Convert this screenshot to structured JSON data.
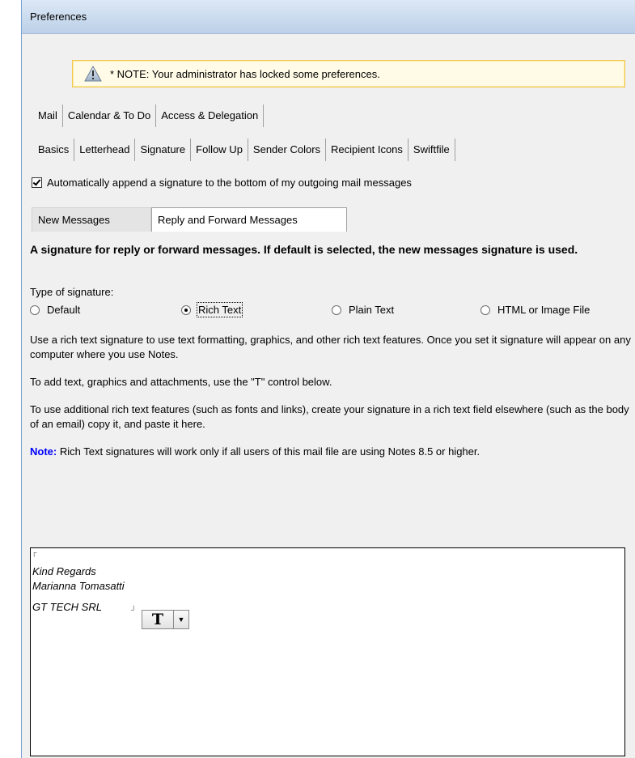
{
  "window": {
    "title": "Preferences"
  },
  "note": {
    "text": "* NOTE: Your administrator has locked some preferences."
  },
  "main_tabs": [
    "Mail",
    "Calendar & To Do",
    "Access & Delegation"
  ],
  "mail_tabs": [
    "Basics",
    "Letterhead",
    "Signature",
    "Follow Up",
    "Sender Colors",
    "Recipient Icons",
    "Swiftfile"
  ],
  "auto_append": {
    "label": "Automatically append a signature to the bottom of my outgoing mail messages",
    "checked": true
  },
  "signature_tabs": {
    "new": "New Messages",
    "reply": "Reply and Forward Messages"
  },
  "heading": "A signature for reply or forward messages. If default is selected, the new messages signature is used.",
  "type_label": "Type of signature:",
  "radio": {
    "default": "Default",
    "rich_text": "Rich Text",
    "plain_text": "Plain Text",
    "html_file": "HTML or Image File",
    "selected": "Rich Text"
  },
  "paragraphs": {
    "p1": "Use a rich text signature to use text formatting, graphics, and other rich text features.  Once you set it signature will appear on any computer where you use Notes.",
    "p2": "To add text, graphics and attachments, use the \"T\" control below.",
    "p3": "To use additional rich text features (such as fonts and links), create your signature in a rich text field elsewhere (such as the body of an email) copy it, and paste it here.",
    "note_label": "Note:",
    "note_text": "Rich Text signatures will work only if all users of this mail file are using Notes 8.5 or higher."
  },
  "signature": {
    "line1": "Kind Regards",
    "line2": "Marianna Tomasatti",
    "line3": "GT TECH SRL",
    "control_label": "T"
  },
  "colors": {
    "note_bg": "#fffbe6",
    "note_border": "#f3c84a",
    "note_label": "#0000ff"
  }
}
